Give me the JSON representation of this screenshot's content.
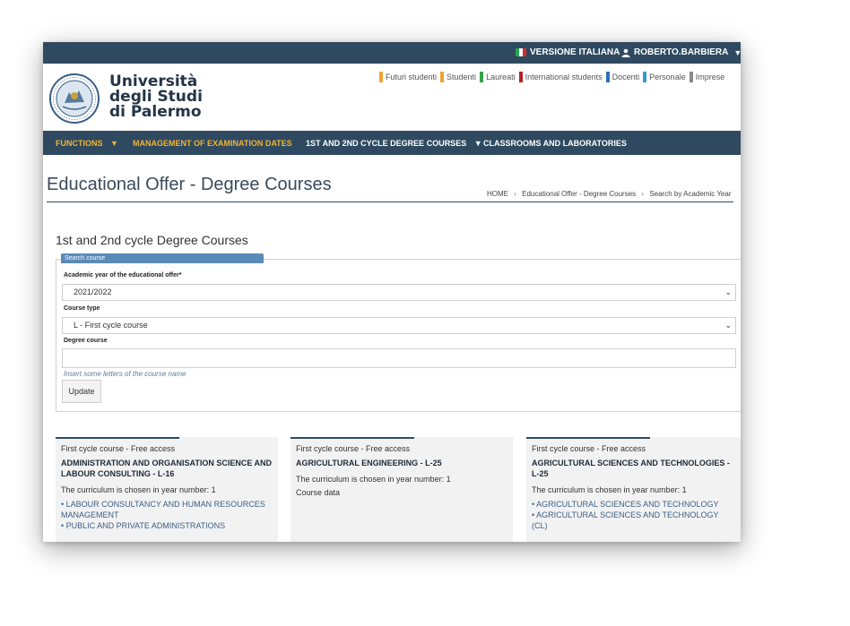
{
  "topbar": {
    "language_label": "VERSIONE ITALIANA",
    "user_label": "ROBERTO.BARBIERA",
    "caret": "▼",
    "flag_colors": [
      "#2aa34a",
      "#ffffff",
      "#d62b2b"
    ]
  },
  "header": {
    "logo_line1": "Università",
    "logo_line2": "degli Studi",
    "logo_line3": "di Palermo",
    "audiences": [
      {
        "label": "Futuri studenti",
        "color": "#f2a130"
      },
      {
        "label": "Studenti",
        "color": "#f2a130"
      },
      {
        "label": "Laureati",
        "color": "#37a34a"
      },
      {
        "label": "International students",
        "color": "#b22222"
      },
      {
        "label": "Docenti",
        "color": "#2f6fb5"
      },
      {
        "label": "Personale",
        "color": "#2f9cc9"
      },
      {
        "label": "Imprese",
        "color": "#8a8a8a"
      }
    ]
  },
  "nav": {
    "functions": "FUNCTIONS",
    "exam_dates": "MANAGEMENT OF EXAMINATION DATES",
    "degree_courses": "1ST AND 2ND CYCLE DEGREE COURSES",
    "classrooms": "CLASSROOMS AND LABORATORIES",
    "caret": "▼"
  },
  "page": {
    "title": "Educational Offer - Degree Courses",
    "breadcrumb": [
      "HOME",
      "Educational Offer - Degree Courses",
      "Search by Academic Year"
    ],
    "breadcrumb_sep": "›",
    "section_title": "1st and 2nd cycle Degree Courses"
  },
  "search": {
    "tab_label": "Search course",
    "year_label": "Academic year of the educational offer*",
    "year_value": "2021/2022",
    "type_label": "Course type",
    "type_value": "L - First cycle course",
    "degree_label": "Degree course",
    "degree_value": "",
    "hint": "Insert some letters of the course name",
    "update_label": "Update",
    "chevron": "⌄"
  },
  "courses": [
    {
      "type": "First cycle course - Free access",
      "name": "ADMINISTRATION AND ORGANISATION SCIENCE AND LABOUR CONSULTING - L-16",
      "curriculum": "The curriculum is chosen in year number: 1",
      "items": [
        "LABOUR CONSULTANCY AND HUMAN RESOURCES MANAGEMENT",
        "PUBLIC AND PRIVATE ADMINISTRATIONS"
      ]
    },
    {
      "type": "First cycle course - Free access",
      "name": "AGRICULTURAL ENGINEERING - L-25",
      "curriculum": "The curriculum is chosen in year number: 1",
      "data": "Course data"
    },
    {
      "type": "First cycle course - Free access",
      "name": "AGRICULTURAL SCIENCES AND TECHNOLOGIES - L-25",
      "curriculum": "The curriculum is chosen in year number: 1",
      "items": [
        "AGRICULTURAL SCIENCES AND TECHNOLOGY",
        "AGRICULTURAL SCIENCES AND TECHNOLOGY (CL)"
      ]
    }
  ]
}
